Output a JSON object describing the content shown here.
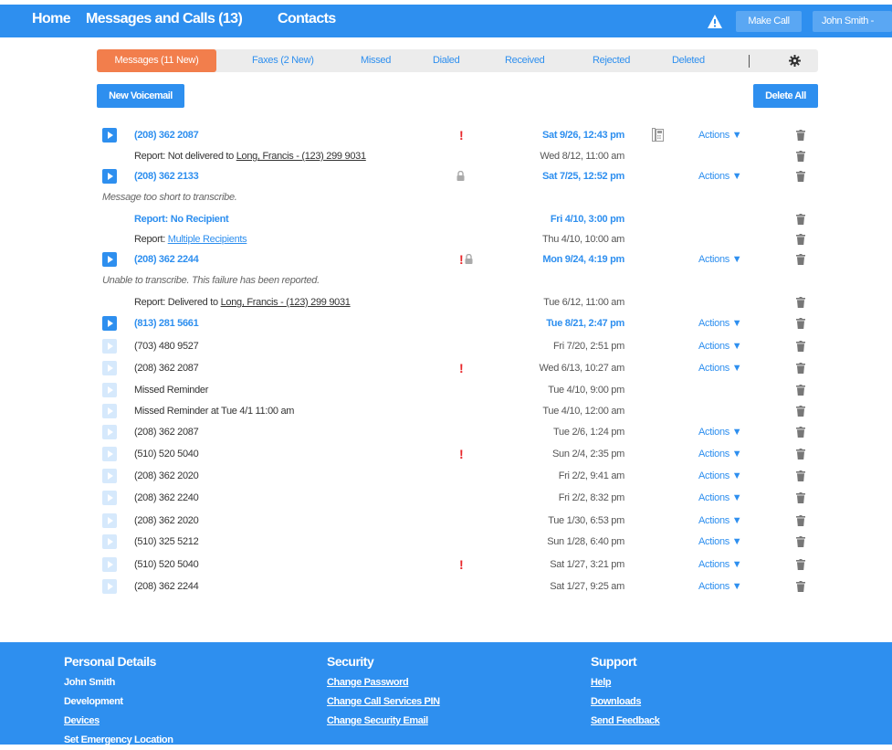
{
  "nav": {
    "home": "Home",
    "messages_calls": "Messages and Calls (13)",
    "contacts": "Contacts",
    "make_call": "Make Call",
    "user_menu": "John Smith -"
  },
  "tabs": {
    "messages": "Messages (11 New)",
    "faxes": "Faxes (2 New)",
    "missed": "Missed",
    "dialed": "Dialed",
    "received": "Received",
    "rejected": "Rejected",
    "deleted": "Deleted"
  },
  "toolbar": {
    "new_voicemail": "New Voicemail",
    "delete_all": "Delete All"
  },
  "actions_label": "Actions ▼",
  "rows": [
    {
      "type": "item",
      "play": "active",
      "title": "(208) 362 2087",
      "bold": true,
      "date": "Sat 9/26, 12:43 pm",
      "urgent": true,
      "fax": true,
      "actions": true
    },
    {
      "type": "report",
      "prefix": "Report: Not delivered to ",
      "link": "Long, Francis - (123) 299 9031",
      "date": "Wed 8/12, 11:00 am"
    },
    {
      "type": "item",
      "play": "active",
      "title": "(208) 362 2133",
      "bold": true,
      "date": "Sat 7/25, 12:52 pm",
      "lock": true,
      "actions": true
    },
    {
      "type": "note",
      "text": "Message too short to transcribe."
    },
    {
      "type": "report",
      "prefix": "Report: No Recipient",
      "bold": true,
      "date": "Fri 4/10, 3:00 pm",
      "date_bold": true
    },
    {
      "type": "report",
      "prefix": "Report: ",
      "link": "Multiple Recipients",
      "link_blue": true,
      "date": "Thu 4/10, 10:00 am"
    },
    {
      "type": "item",
      "play": "active",
      "title": "(208) 362 2244",
      "bold": true,
      "date": "Mon 9/24, 4:19 pm",
      "urgent": true,
      "lock": true,
      "actions": true
    },
    {
      "type": "note",
      "text": "Unable to transcribe. This failure has been reported."
    },
    {
      "type": "report",
      "prefix": "Report: Delivered to ",
      "link": "Long, Francis - (123) 299 9031",
      "date": "Tue 6/12, 11:00 am"
    },
    {
      "type": "item",
      "play": "active",
      "title": "(813) 281 5661",
      "bold": true,
      "date": "Tue 8/21, 2:47 pm",
      "actions": true
    },
    {
      "type": "item",
      "play": "dim",
      "title": "(703) 480 9527",
      "date": "Fri 7/20, 2:51 pm",
      "actions": true
    },
    {
      "type": "item",
      "play": "dim",
      "title": "(208) 362 2087",
      "date": "Wed 6/13, 10:27 am",
      "urgent": true,
      "actions": true
    },
    {
      "type": "item",
      "play": "dim",
      "title": "Missed Reminder",
      "date": "Tue 4/10, 9:00 pm"
    },
    {
      "type": "item",
      "play": "dim",
      "title": "Missed Reminder at Tue 4/1 11:00 am",
      "date": "Tue 4/10, 12:00 am"
    },
    {
      "type": "item",
      "play": "dim",
      "title": "(208) 362 2087",
      "date": "Tue 2/6, 1:24 pm",
      "actions": true
    },
    {
      "type": "item",
      "play": "dim",
      "title": "(510) 520 5040",
      "date": "Sun 2/4, 2:35 pm",
      "urgent": true,
      "actions": true
    },
    {
      "type": "item",
      "play": "dim",
      "title": "(208) 362 2020",
      "date": "Fri 2/2, 9:41 am",
      "actions": true
    },
    {
      "type": "item",
      "play": "dim",
      "title": "(208) 362 2240",
      "date": "Fri 2/2, 8:32 pm",
      "actions": true
    },
    {
      "type": "item",
      "play": "dim",
      "title": "(208) 362 2020",
      "date": "Tue 1/30, 6:53 pm",
      "actions": true
    },
    {
      "type": "item",
      "play": "dim",
      "title": "(510) 325 5212",
      "date": "Sun 1/28, 6:40 pm",
      "actions": true
    },
    {
      "type": "item",
      "play": "dim",
      "title": "(510) 520 5040",
      "date": "Sat 1/27, 3:21 pm",
      "urgent": true,
      "actions": true
    },
    {
      "type": "item",
      "play": "dim",
      "title": "(208) 362 2244",
      "date": "Sat 1/27, 9:25 am",
      "actions": true
    }
  ],
  "footer": {
    "personal": {
      "heading": "Personal Details",
      "name": "John Smith",
      "dept": "Development",
      "devices": "Devices",
      "emergency": "Set Emergency Location"
    },
    "security": {
      "heading": "Security",
      "password": "Change Password",
      "pin": "Change Call Services PIN",
      "email": "Change Security Email"
    },
    "support": {
      "heading": "Support",
      "help": "Help",
      "downloads": "Downloads",
      "feedback": "Send Feedback"
    }
  },
  "colors": {
    "brand_blue": "#2e8fef",
    "active_tab": "#f27e4c",
    "urgent_red": "#e8262a",
    "dim_play": "#d6e9fc"
  }
}
